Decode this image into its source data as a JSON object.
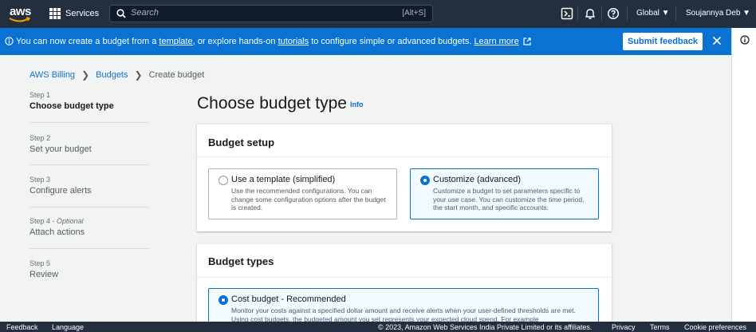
{
  "topnav": {
    "logo_text": "aws",
    "services_label": "Services",
    "search_placeholder": "Search",
    "search_shortcut": "[Alt+S]",
    "region": "Global ▼",
    "user": "Soujannya Deb ▼"
  },
  "flash": {
    "msg_part1": "You can now create a budget from a ",
    "template_link": "template",
    "msg_part2": ", or explore hands-on ",
    "tutorials_link": "tutorials",
    "msg_part3": " to configure simple or advanced budgets. ",
    "learn_more": "Learn more",
    "submit_feedback": "Submit feedback"
  },
  "breadcrumb": {
    "items": [
      "AWS Billing",
      "Budgets",
      "Create budget"
    ]
  },
  "steps": [
    {
      "label": "Step 1",
      "name": "Choose budget type",
      "optional": ""
    },
    {
      "label": "Step 2",
      "name": "Set your budget",
      "optional": ""
    },
    {
      "label": "Step 3",
      "name": "Configure alerts",
      "optional": ""
    },
    {
      "label": "Step 4 - ",
      "name": "Attach actions",
      "optional": "Optional"
    },
    {
      "label": "Step 5",
      "name": "Review",
      "optional": ""
    }
  ],
  "main": {
    "title": "Choose budget type",
    "info": "Info",
    "setup": {
      "header": "Budget setup",
      "options": [
        {
          "title": "Use a template (simplified)",
          "desc": "Use the recommended configurations. You can change some configuration options after the budget is created.",
          "selected": false
        },
        {
          "title": "Customize (advanced)",
          "desc": "Customize a budget to set parameters specific to your use case. You can customize the time period, the start month, and specific accounts.",
          "selected": true
        }
      ]
    },
    "types": {
      "header": "Budget types",
      "options": [
        {
          "title": "Cost budget - Recommended",
          "desc": "Monitor your costs against a specified dollar amount and receive alerts when your user-defined thresholds are met. Using cost budgets, the budgeted amount you set represents your expected cloud spend. For example",
          "selected": true
        }
      ]
    }
  },
  "footer": {
    "feedback": "Feedback",
    "language": "Language",
    "copyright": "© 2023, Amazon Web Services India Private Limited or its affiliates.",
    "privacy": "Privacy",
    "terms": "Terms",
    "cookies": "Cookie preferences"
  },
  "colors": {
    "nav_bg": "#232f3e",
    "flash_bg": "#0972d3",
    "link": "#0972d3",
    "page_bg": "#f2f3f3"
  }
}
